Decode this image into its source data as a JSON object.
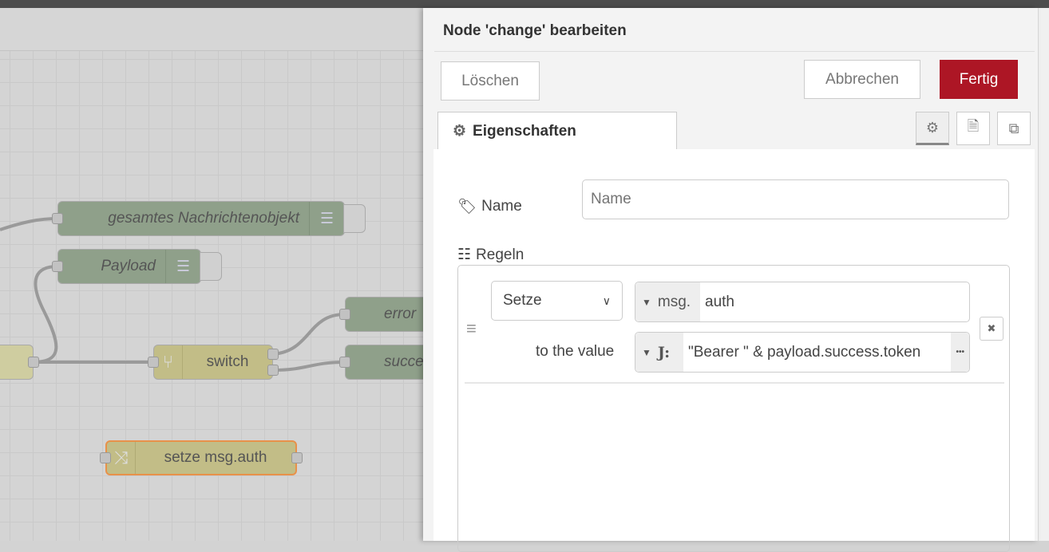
{
  "canvas": {
    "nodes": {
      "debug1": "gesamtes Nachrichtenobjekt",
      "debug2": "Payload",
      "error": "error",
      "success": "succe",
      "switch": "switch",
      "change": "setze msg.auth"
    },
    "colors": {
      "debug_node": "#8fa08a",
      "function_node": "#c2bd87",
      "selected_border": "#e8914a"
    }
  },
  "dialog": {
    "title": "Node 'change' bearbeiten",
    "delete_label": "Löschen",
    "cancel_label": "Abbrechen",
    "done_label": "Fertig",
    "done_color": "#ad1625",
    "tab_label": "Eigenschaften",
    "name_label": "Name",
    "name_placeholder": "Name",
    "name_value": "",
    "rules_label": "Regeln",
    "rule": {
      "action": "Setze",
      "target_type": "msg.",
      "target_value": "auth",
      "to_label": "to the value",
      "value_type": "J:",
      "value": "\"Bearer \" & payload.success.token",
      "more": "•••",
      "delete": "✖"
    }
  }
}
